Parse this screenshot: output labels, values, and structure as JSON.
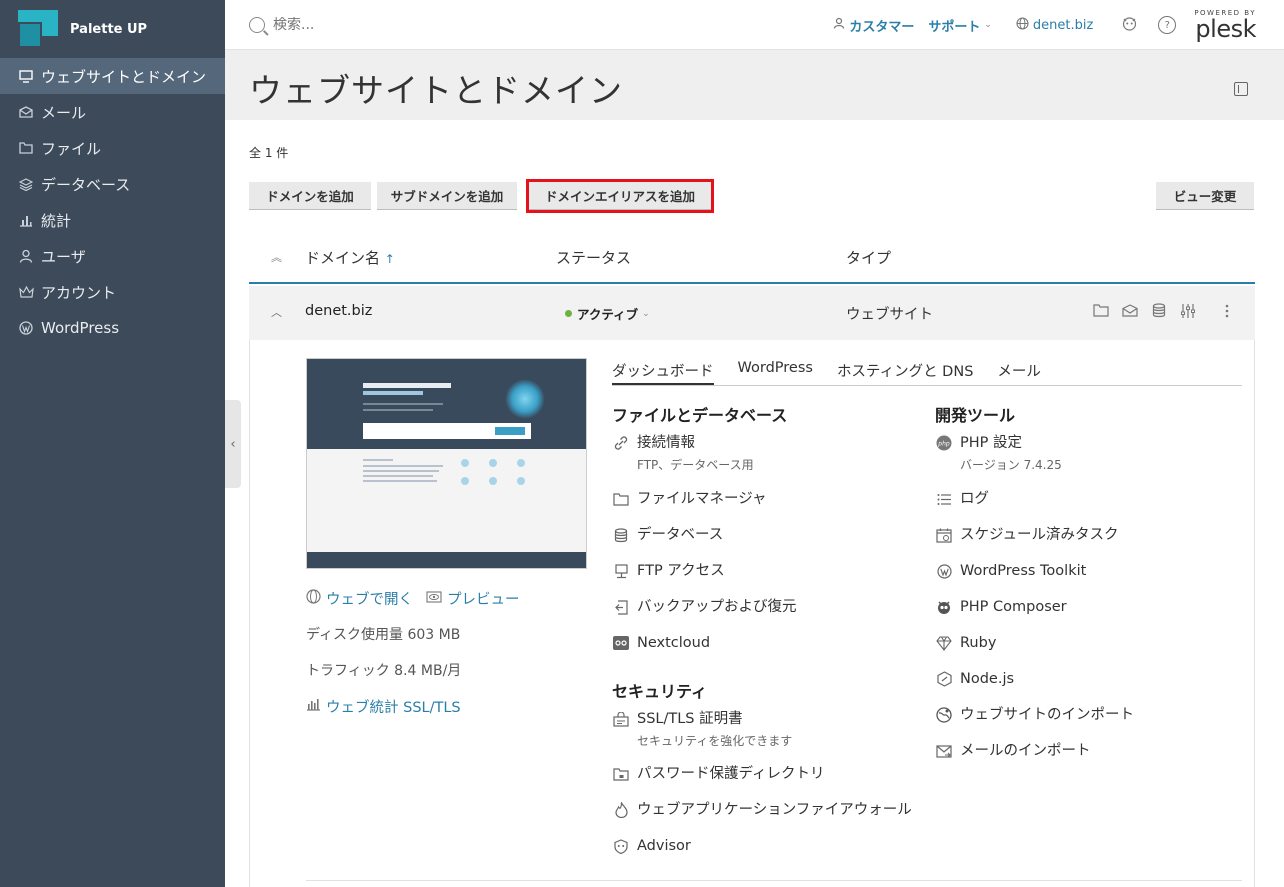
{
  "brand": {
    "name": "Palette UP"
  },
  "sidebar": {
    "items": [
      {
        "label": "ウェブサイトとドメイン",
        "icon": "monitor-icon"
      },
      {
        "label": "メール",
        "icon": "mail-icon"
      },
      {
        "label": "ファイル",
        "icon": "folder-icon"
      },
      {
        "label": "データベース",
        "icon": "stack-icon"
      },
      {
        "label": "統計",
        "icon": "bar-chart-icon"
      },
      {
        "label": "ユーザ",
        "icon": "user-icon"
      },
      {
        "label": "アカウント",
        "icon": "crown-icon"
      },
      {
        "label": "WordPress",
        "icon": "wordpress-icon"
      }
    ]
  },
  "header": {
    "search_placeholder": "検索...",
    "customer": "カスタマー",
    "support": "サポート",
    "domain": "denet.biz",
    "powered_by": "POWERED BY",
    "plesk": "plesk"
  },
  "page": {
    "title": "ウェブサイトとドメイン"
  },
  "list": {
    "count": "全 1 件",
    "buttons": {
      "add_domain": "ドメインを追加",
      "add_subdomain": "サブドメインを追加",
      "add_alias": "ドメインエイリアスを追加",
      "change_view": "ビュー変更"
    },
    "columns": {
      "name": "ドメイン名",
      "sort_arrow": "↑",
      "status": "ステータス",
      "type": "タイプ"
    }
  },
  "domain_row": {
    "name": "denet.biz",
    "status": "アクティブ",
    "type": "ウェブサイト"
  },
  "detail": {
    "open_web": "ウェブで開く",
    "preview": "プレビュー",
    "disk_usage": "ディスク使用量 603 MB",
    "traffic": "トラフィック 8.4 MB/月",
    "web_stats": "ウェブ統計 SSL/TLS",
    "tabs": [
      "ダッシュボード",
      "WordPress",
      "ホスティングと DNS",
      "メール"
    ],
    "files_db": {
      "title": "ファイルとデータベース",
      "items": [
        {
          "label": "接続情報",
          "sub": "FTP、データベース用"
        },
        {
          "label": "ファイルマネージャ"
        },
        {
          "label": "データベース"
        },
        {
          "label": "FTP アクセス"
        },
        {
          "label": "バックアップおよび復元"
        },
        {
          "label": "Nextcloud"
        }
      ]
    },
    "security": {
      "title": "セキュリティ",
      "items": [
        {
          "label": "SSL/TLS 証明書",
          "sub": "セキュリティを強化できます"
        },
        {
          "label": "パスワード保護ディレクトリ"
        },
        {
          "label": "ウェブアプリケーションファイアウォール"
        },
        {
          "label": "Advisor"
        }
      ]
    },
    "dev_tools": {
      "title": "開発ツール",
      "items": [
        {
          "label": "PHP 設定",
          "sub": "バージョン 7.4.25"
        },
        {
          "label": "ログ"
        },
        {
          "label": "スケジュール済みタスク"
        },
        {
          "label": "WordPress Toolkit"
        },
        {
          "label": "PHP Composer"
        },
        {
          "label": "Ruby"
        },
        {
          "label": "Node.js"
        },
        {
          "label": "ウェブサイトのインポート"
        },
        {
          "label": "メールのインポート"
        }
      ]
    }
  },
  "colors": {
    "sidebar": "#3c4a5a",
    "accent": "#2a7fa8",
    "highlight": "#e3121c",
    "active_dot": "#6cb33f"
  }
}
